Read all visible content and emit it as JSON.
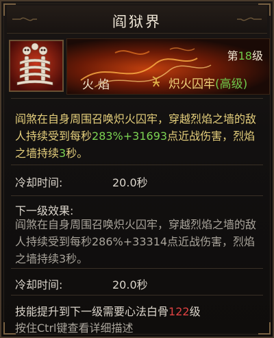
{
  "tooltip": {
    "title": "阎狱界",
    "icon_name": "skeleton-skill-icon",
    "element": "火焰",
    "level_prefix": "第",
    "level_number": "18",
    "level_suffix": "级",
    "skill_icon": "flame-rune-icon",
    "skill_name": "炽火囚牢",
    "skill_grade": "(高级)"
  },
  "current": {
    "desc_part1": "阎煞在自身周围召唤炽火囚牢，穿越烈焰之墙的敌人持续受到每秒",
    "desc_values": "283%+31693",
    "desc_part2": "点近战伤害，烈焰之墙持续",
    "desc_duration": "3",
    "desc_part3": "秒。",
    "cooldown_label": "冷却时间:",
    "cooldown_value": "20.0秒"
  },
  "next_level": {
    "header": "下一级效果:",
    "desc": "阎煞在自身周围召唤炽火囚牢，穿越烈焰之墙的敌人持续受到每秒286%+33314点近战伤害，烈焰之墙持续3秒。",
    "cooldown_label": "冷却时间:",
    "cooldown_value": "20.0秒"
  },
  "requirement": {
    "text_before": "技能提升到下一级需要心法白骨",
    "level": "122",
    "text_after": "级"
  },
  "hint": "按住Ctrl键查看详细描述",
  "colors": {
    "gold_text": "#e5cf7c",
    "green_value": "#7cd352",
    "red_value": "#e04343",
    "border": "#4a3b2c"
  }
}
